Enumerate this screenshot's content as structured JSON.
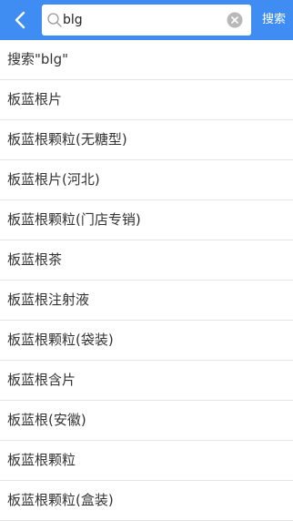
{
  "colors": {
    "header_bg": "#3f8df2",
    "header_text": "#ffffff",
    "list_text": "#333333",
    "divider": "#e6e6e6",
    "clear_icon": "#b8b8b8"
  },
  "header": {
    "back_icon": "chevron-left-icon",
    "search": {
      "value": "blg",
      "icon": "search-icon",
      "clear_icon": "clear-icon"
    },
    "search_button_label": "搜索"
  },
  "suggestions": [
    "搜索\"blg\"",
    "板蓝根片",
    "板蓝根颗粒(无糖型)",
    "板蓝根片(河北)",
    "板蓝根颗粒(门店专销)",
    "板蓝根茶",
    "板蓝根注射液",
    "板蓝根颗粒(袋装)",
    "板蓝根含片",
    "板蓝根(安徽)",
    "板蓝根颗粒",
    "板蓝根颗粒(盒装)"
  ]
}
